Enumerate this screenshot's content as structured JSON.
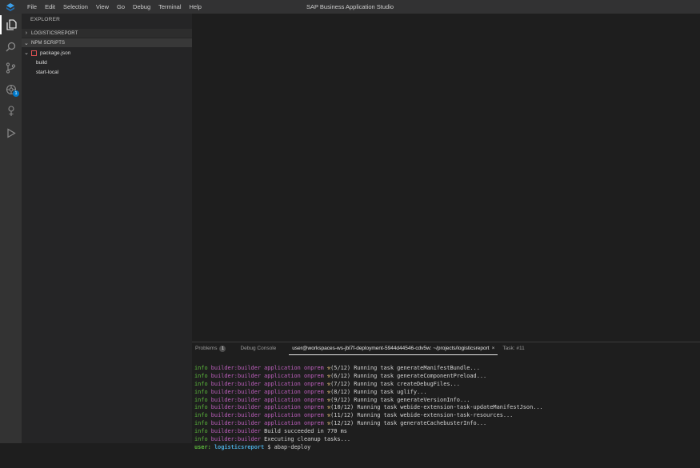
{
  "window": {
    "title": "SAP Business Application Studio",
    "menu": [
      "File",
      "Edit",
      "Selection",
      "View",
      "Go",
      "Debug",
      "Terminal",
      "Help"
    ]
  },
  "activity_bar": {
    "items": [
      {
        "name": "explorer-icon",
        "active": true
      },
      {
        "name": "search-icon",
        "active": false
      },
      {
        "name": "source-control-icon",
        "active": false
      },
      {
        "name": "extensions-icon",
        "active": false,
        "badge": "1"
      },
      {
        "name": "remote-icon",
        "active": false
      },
      {
        "name": "run-debug-icon",
        "active": false
      }
    ]
  },
  "sidebar": {
    "title": "EXPLORER",
    "sections": {
      "project": "LOGISTICSREPORT",
      "npm": "NPM SCRIPTS"
    },
    "tree": {
      "file": "package.json",
      "scripts": [
        "build",
        "start-local"
      ]
    }
  },
  "panel": {
    "tabs": {
      "problems": "Problems",
      "problems_count": "1",
      "debug_console": "Debug Console",
      "terminal": "user@workspaces-ws-jbl7f-deployment-5944d44546-cdv5w: ~/projects/logisticsreport",
      "terminal_close": "×",
      "task": "Task: #11"
    },
    "terminal_lines": [
      {
        "info": "info",
        "builder": "builder:builder",
        "app": "application onprem",
        "icon": "⚒",
        "text": "(5/12) Running task generateManifestBundle..."
      },
      {
        "info": "info",
        "builder": "builder:builder",
        "app": "application onprem",
        "icon": "⚒",
        "text": "(6/12) Running task generateComponentPreload..."
      },
      {
        "info": "info",
        "builder": "builder:builder",
        "app": "application onprem",
        "icon": "⚒",
        "text": "(7/12) Running task createDebugFiles..."
      },
      {
        "info": "info",
        "builder": "builder:builder",
        "app": "application onprem",
        "icon": "⚒",
        "text": "(8/12) Running task uglify..."
      },
      {
        "info": "info",
        "builder": "builder:builder",
        "app": "application onprem",
        "icon": "⚒",
        "text": "(9/12) Running task generateVersionInfo..."
      },
      {
        "info": "info",
        "builder": "builder:builder",
        "app": "application onprem",
        "icon": "⚒",
        "text": "(10/12) Running task webide-extension-task-updateManifestJson..."
      },
      {
        "info": "info",
        "builder": "builder:builder",
        "app": "application onprem",
        "icon": "⚒",
        "text": "(11/12) Running task webide-extension-task-resources..."
      },
      {
        "info": "info",
        "builder": "builder:builder",
        "app": "application onprem",
        "icon": "⚒",
        "text": "(12/12) Running task generateCachebusterInfo..."
      },
      {
        "info": "info",
        "builder": "builder:builder",
        "app": "",
        "icon": "",
        "text": "Build succeeded in 770 ms"
      },
      {
        "info": "info",
        "builder": "builder:builder",
        "app": "",
        "icon": "",
        "text": "Executing cleanup tasks..."
      }
    ],
    "prompt": {
      "user": "user:",
      "dir": "logisticsreport",
      "symbol": "$",
      "command": "abap-deploy"
    }
  },
  "colors": {
    "accent": "#007acc",
    "info": "#5cba3c",
    "builder": "#c060c0"
  }
}
